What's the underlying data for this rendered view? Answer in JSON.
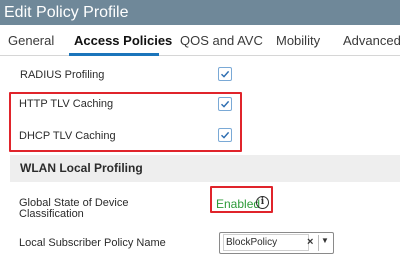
{
  "window": {
    "title": "Edit Policy Profile"
  },
  "tabs": [
    {
      "label": "General",
      "active": false
    },
    {
      "label": "Access Policies",
      "active": true
    },
    {
      "label": "QOS and AVC",
      "active": false
    },
    {
      "label": "Mobility",
      "active": false
    },
    {
      "label": "Advanced",
      "active": false
    }
  ],
  "fields": {
    "radius_profiling": {
      "label": "RADIUS Profiling",
      "checked": true
    },
    "http_tlv_caching": {
      "label": "HTTP TLV Caching",
      "checked": true
    },
    "dhcp_tlv_caching": {
      "label": "DHCP TLV Caching",
      "checked": true
    }
  },
  "section": {
    "title": "WLAN Local Profiling"
  },
  "global_state": {
    "label": "Global State of Device Classification",
    "label_line1": "Global State of Device",
    "label_line2": "Classification",
    "status": "Enabled",
    "info_glyph": "i"
  },
  "subscriber_policy": {
    "label": "Local Subscriber Policy Name",
    "value": "BlockPolicy",
    "clear_glyph": "×",
    "caret_glyph": "▼"
  },
  "colors": {
    "title_bar": "#6f8899",
    "active_tab_underline": "#1b75bb",
    "highlight": "#e0242b",
    "status_enabled": "#2e9b3a",
    "checkbox_border": "#7aa9d6"
  }
}
